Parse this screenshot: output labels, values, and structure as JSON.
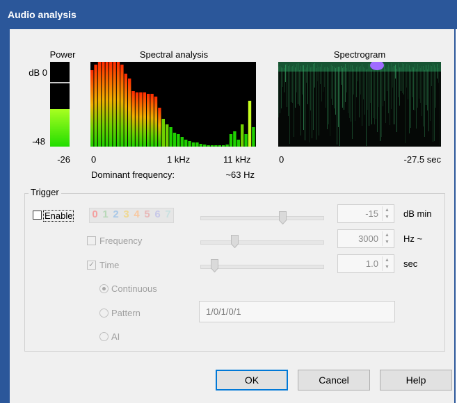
{
  "window": {
    "title": "Audio analysis"
  },
  "power": {
    "heading": "Power",
    "top_label": "dB 0",
    "bottom_label": "-48",
    "value": "-26",
    "level_fraction": 0.44
  },
  "spectral": {
    "heading": "Spectral analysis",
    "tick_left": "0",
    "tick_mid": "1 kHz",
    "tick_right": "11 kHz",
    "dominant_label": "Dominant frequency:",
    "dominant_value": "~63 Hz"
  },
  "spectrogram": {
    "heading": "Spectrogram",
    "tick_left": "0",
    "tick_right": "-27.5 sec"
  },
  "trigger": {
    "legend": "Trigger",
    "enable_label": "Enable",
    "enable_checked": false,
    "digits": [
      "0",
      "1",
      "2",
      "3",
      "4",
      "5",
      "6",
      "7"
    ],
    "db": {
      "value": "-15",
      "unit": "dB min"
    },
    "frequency": {
      "label": "Frequency",
      "checked": false,
      "value": "3000",
      "unit": "Hz ~"
    },
    "time": {
      "label": "Time",
      "checked": true,
      "value": "1.0",
      "unit": "sec"
    },
    "modes": [
      {
        "label": "Continuous",
        "selected": true
      },
      {
        "label": "Pattern",
        "selected": false
      },
      {
        "label": "AI",
        "selected": false
      }
    ],
    "pattern_value": "1/0/1/0/1"
  },
  "buttons": {
    "ok": "OK",
    "cancel": "Cancel",
    "help": "Help"
  },
  "colors": {
    "titlebar": "#2b579a",
    "spectrum_red": "#ff2a00",
    "spectrum_green": "#1fd000",
    "spectrogram_accent": "#a06cff"
  }
}
